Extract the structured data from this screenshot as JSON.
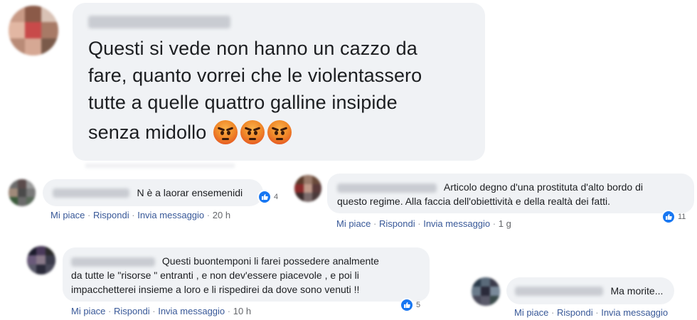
{
  "main_comment": {
    "text_lines": [
      "Questi si vede non hanno un cazzo da",
      "fare, quanto vorrei che le violentassero",
      "tutte a quelle quattro galline insipide",
      "senza midollo"
    ],
    "emoji": [
      "angry-face-icon",
      "angry-face-icon",
      "angry-face-icon"
    ]
  },
  "comments": [
    {
      "text": "N è a laorar ensemenidi",
      "likes": "4",
      "actions": {
        "like": "Mi piace",
        "reply": "Rispondi",
        "message": "Invia messaggio",
        "sep": "·",
        "time": "20 h"
      }
    },
    {
      "text_lines": [
        "Articolo degno d'una prostituta d'alto bordo di",
        "questo regime. Alla faccia dell'obiettività e della realtà dei fatti."
      ],
      "likes": "11",
      "actions": {
        "like": "Mi piace",
        "reply": "Rispondi",
        "message": "Invia messaggio",
        "sep": "·",
        "time": "1 g"
      }
    },
    {
      "text_lines": [
        "Questi buontemponi li farei possedere analmente",
        "da tutte le \"risorse \" entranti , e non dev'essere piacevole , e poi li",
        "impacchetterei insieme a loro e li rispedirei da dove sono venuti !!"
      ],
      "likes": "5",
      "actions": {
        "like": "Mi piace",
        "reply": "Rispondi",
        "message": "Invia messaggio",
        "sep": "·",
        "time": "10 h"
      }
    },
    {
      "text": "Ma morite...",
      "actions": {
        "like": "Mi piace",
        "reply": "Rispondi",
        "message": "Invia messaggio",
        "sep": "·"
      }
    }
  ],
  "colors": {
    "bubble": "#f0f2f5",
    "link": "#385898",
    "like_blue": "#1877f2",
    "meta_gray": "#65676b"
  }
}
